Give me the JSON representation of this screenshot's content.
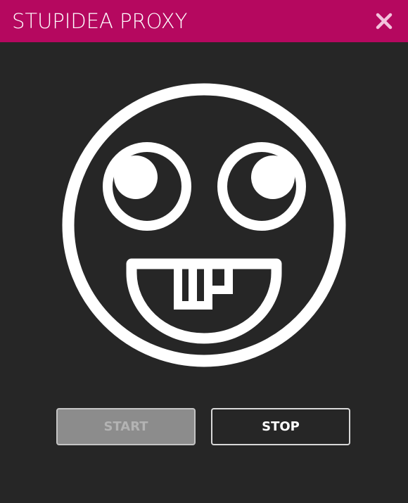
{
  "window": {
    "title": "STUPIDEA PROXY",
    "accent_color": "#b5085f",
    "background_color": "#262626"
  },
  "titlebar": {
    "close_icon": "close-icon"
  },
  "main": {
    "logo_icon": "goofy-face-icon"
  },
  "controls": {
    "start_label": "START",
    "start_state": "disabled",
    "stop_label": "STOP",
    "stop_state": "enabled"
  }
}
